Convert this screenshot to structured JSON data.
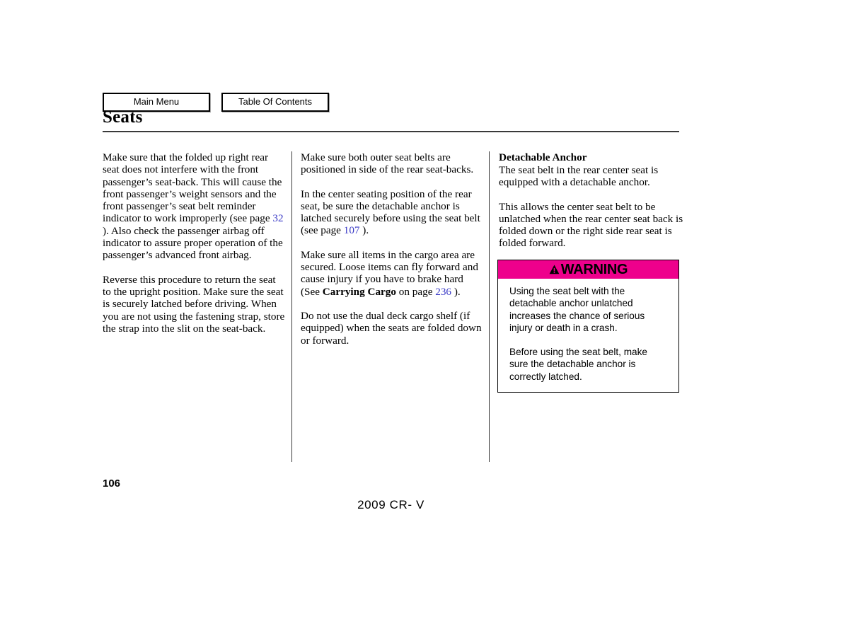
{
  "nav": {
    "main_menu_label": "Main Menu",
    "table_of_contents_label": "Table Of Contents"
  },
  "header": {
    "chapter_title": "Seats"
  },
  "colors": {
    "warning_header_bg": "#ee008c",
    "page_reference_link": "#3a3ac6",
    "rule": "#3a3a3a",
    "text": "#000000"
  },
  "columns": {
    "column1": {
      "paragraphs": [
        {
          "segments": [
            {
              "type": "text",
              "text": "Make sure that the folded up right rear seat does not interfere with the front passenger’s seat-back. This will cause the front passenger’s weight sensors and the front passenger’s seat belt reminder indicator to work improperly (see page "
            },
            {
              "type": "ref",
              "text": "32"
            },
            {
              "type": "text",
              "text": " ). Also check the passenger airbag off indicator to assure proper operation of the passenger’s advanced front airbag."
            }
          ]
        },
        {
          "segments": [
            {
              "type": "text",
              "text": "Reverse this procedure to return the seat to the upright position. Make sure the seat is securely latched before driving. When you are not using the fastening strap, store the strap into the slit on the seat-back."
            }
          ]
        }
      ]
    },
    "column2": {
      "paragraphs": [
        {
          "segments": [
            {
              "type": "text",
              "text": "Make sure both outer seat belts are positioned in side of the rear seat-backs."
            }
          ]
        },
        {
          "segments": [
            {
              "type": "text",
              "text": "In the center seating position of the rear seat, be sure the detachable anchor is latched securely before using the seat belt (see page "
            },
            {
              "type": "ref",
              "text": "107"
            },
            {
              "type": "text",
              "text": " )."
            }
          ]
        },
        {
          "segments": [
            {
              "type": "text",
              "text": "Make sure all items in the cargo area are secured. Loose items can fly forward and cause injury if you have to brake hard (See "
            },
            {
              "type": "bold",
              "text": "Carrying Cargo"
            },
            {
              "type": "text",
              "text": " on page "
            },
            {
              "type": "ref",
              "text": "236"
            },
            {
              "type": "text",
              "text": " )."
            }
          ]
        },
        {
          "segments": [
            {
              "type": "text",
              "text": "Do not use the dual deck cargo shelf (if equipped) when the seats are folded down or forward."
            }
          ]
        }
      ]
    },
    "column3": {
      "subheading": "Detachable Anchor",
      "paragraphs": [
        {
          "segments": [
            {
              "type": "text",
              "text": "The seat belt in the rear center seat is equipped with a detachable anchor."
            }
          ]
        },
        {
          "segments": [
            {
              "type": "text",
              "text": "This allows the center seat belt to be unlatched when the rear center seat back is folded down or the right side rear seat is folded forward."
            }
          ]
        }
      ]
    }
  },
  "warning": {
    "icon": "warning-triangle-icon",
    "title": "WARNING",
    "paragraphs": [
      "Using the seat belt with the detachable anchor unlatched increases the chance of serious injury or death in a crash.",
      "Before using the seat belt, make sure the detachable anchor is correctly latched."
    ]
  },
  "footer": {
    "page_number": "106",
    "model_year_text": "2009  CR- V"
  }
}
